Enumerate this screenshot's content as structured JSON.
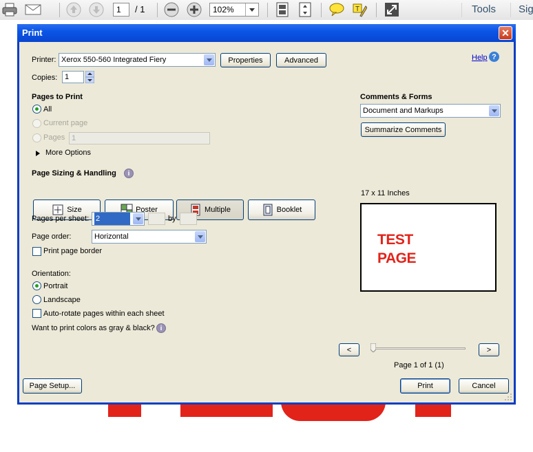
{
  "toolbar": {
    "page_current": "1",
    "page_total": "/ 1",
    "zoom": "102%",
    "tools_label": "Tools",
    "sign_label": "Sig"
  },
  "dialog": {
    "title": "Print",
    "help_label": "Help",
    "printer_label": "Printer:",
    "printer_value": "Xerox 550-560 Integrated Fiery",
    "properties_label": "Properties",
    "advanced_label": "Advanced",
    "copies_label": "Copies:",
    "copies_value": "1",
    "pages_to_print": {
      "heading": "Pages to Print",
      "all_label": "All",
      "current_label": "Current page",
      "pages_label": "Pages",
      "pages_value": "1",
      "more_options": "More Options",
      "selected": "All"
    },
    "comments": {
      "heading": "Comments & Forms",
      "value": "Document and Markups",
      "summarize_label": "Summarize Comments"
    },
    "sizing": {
      "heading": "Page Sizing & Handling",
      "size_label": "Size",
      "poster_label": "Poster",
      "multiple_label": "Multiple",
      "booklet_label": "Booklet",
      "selected": "Multiple"
    },
    "multiple": {
      "pages_per_sheet_label": "Pages per sheet:",
      "pages_per_sheet_value": "2",
      "by_label": "by",
      "page_order_label": "Page order:",
      "page_order_value": "Horizontal",
      "border_label": "Print page border"
    },
    "orientation": {
      "heading": "Orientation:",
      "portrait_label": "Portrait",
      "landscape_label": "Landscape",
      "autorotate_label": "Auto-rotate pages within each sheet",
      "selected": "Portrait"
    },
    "gray_question": "Want to print colors as gray & black?",
    "preview": {
      "size_label": "17 x 11 Inches",
      "text_line1": "TEST",
      "text_line2": "PAGE",
      "prev_label": "<",
      "next_label": ">",
      "page_info": "Page 1 of 1 (1)",
      "slider_value": 0
    },
    "page_setup_label": "Page Setup...",
    "print_label": "Print",
    "cancel_label": "Cancel"
  },
  "colors": {
    "title_bar": "#0b55e6",
    "dialog_bg": "#ece9d8",
    "close_button": "#c9381a",
    "test_page_red": "#e2231a"
  }
}
